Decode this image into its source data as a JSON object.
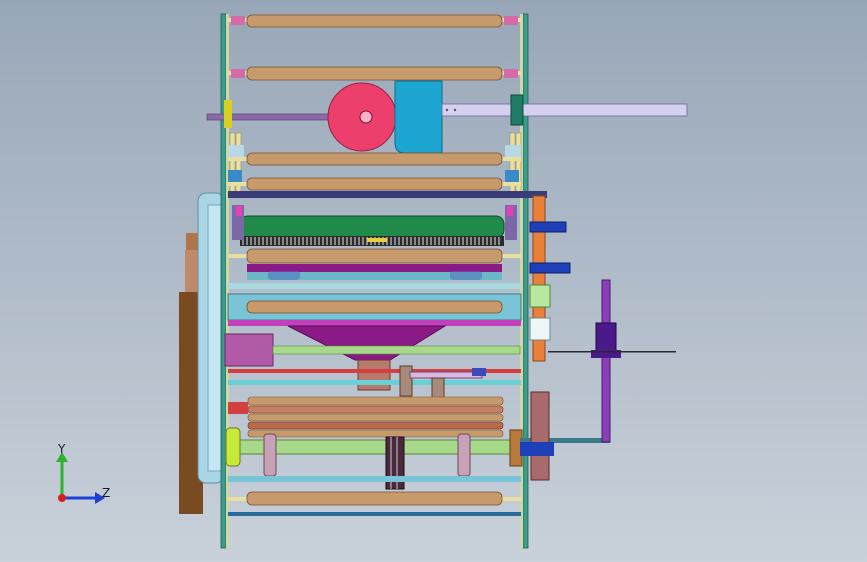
{
  "viewport": {
    "background_top": "#98a7b8",
    "background_bottom": "#c9d1da"
  },
  "triad": {
    "y_label": "Y",
    "z_label": "Z",
    "y_color": "#2fb12f",
    "z_color": "#1f3fd6",
    "x_color": "#d41f1f"
  },
  "colors": {
    "roller": "#c69a6a",
    "roller_dark": "#9a6f46",
    "frame": "#3c9b8c",
    "green_roller": "#1f8a4a",
    "pink_pulley": "#ec3f6b",
    "cyan_block": "#1ea6d2",
    "purple_hopper": "#8a1a86",
    "brown_block": "#7a4a20",
    "light_panel": "#a9d6e6",
    "violet_post": "#8a3fb8"
  }
}
